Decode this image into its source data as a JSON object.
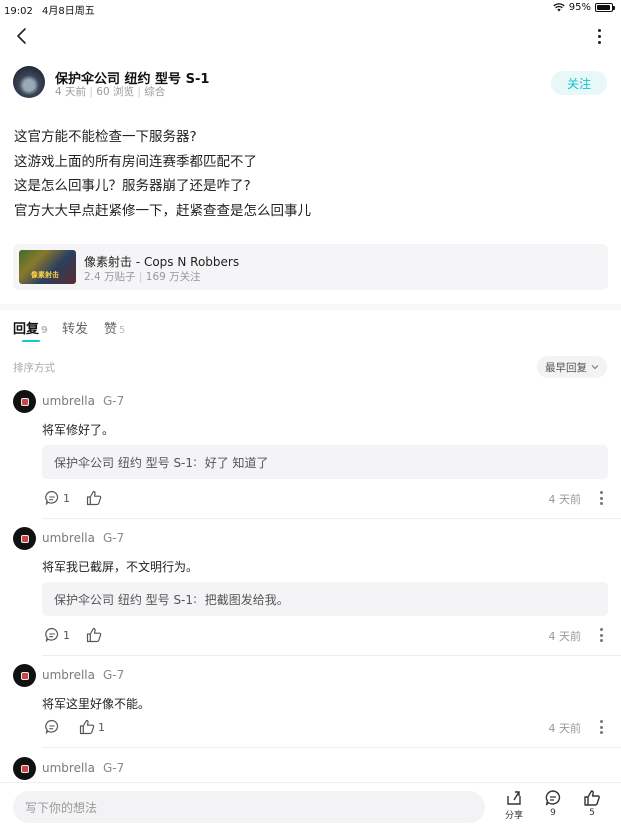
{
  "status_bar": {
    "time": "19:02",
    "date": "4月8日周五",
    "battery": "95%",
    "battery_level": 0.95
  },
  "post": {
    "author": "保护伞公司 纽约 型号 S-1",
    "posted": "4 天前",
    "views": "60 浏览",
    "category": "综合",
    "follow_label": "关注",
    "lines": [
      "这官方能不能检查一下服务器?",
      "这游戏上面的所有房间连赛季都匹配不了",
      "这是怎么回事儿？服务器崩了还是咋了?",
      "官方大大早点赶紧修一下，赶紧查查是怎么回事儿"
    ]
  },
  "game": {
    "name": "像素射击 - Cops N Robbers",
    "posts": "2.4 万贴子",
    "followers": "169 万关注",
    "thumb_text": "像素射击"
  },
  "tabs": [
    {
      "label": "回复",
      "count": "9"
    },
    {
      "label": "转发",
      "count": ""
    },
    {
      "label": "赞",
      "count": "5"
    }
  ],
  "sort": {
    "label": "排序方式",
    "selected": "最早回复"
  },
  "replies": [
    {
      "user": "umbrella",
      "level": "G-7",
      "text": "将军修好了。",
      "quote_author": "保护伞公司 纽约 型号 S-1",
      "quote_text": "好了 知道了",
      "comments": "1",
      "likes": "",
      "time": "4 天前"
    },
    {
      "user": "umbrella",
      "level": "G-7",
      "text": "将军我已截屏，不文明行为。",
      "quote_author": "保护伞公司 纽约 型号 S-1",
      "quote_text": "把截图发给我。",
      "comments": "1",
      "likes": "",
      "time": "4 天前"
    },
    {
      "user": "umbrella",
      "level": "G-7",
      "text": "将军这里好像不能。",
      "quote_author": "",
      "quote_text": "",
      "comments": "",
      "likes": "1",
      "time": "4 天前"
    },
    {
      "user": "umbrella",
      "level": "G-7",
      "text": "",
      "quote_author": "",
      "quote_text": "",
      "comments": "",
      "likes": "",
      "time": ""
    }
  ],
  "bottom": {
    "placeholder": "写下你的想法",
    "share": "分享",
    "comments": "9",
    "likes": "5"
  },
  "colors": {
    "accent": "#15c5ce",
    "follow_bg": "#e8f7f8"
  },
  "icons": [
    "back-icon",
    "more-icon",
    "wifi-icon",
    "battery-icon",
    "comment-icon",
    "like-icon",
    "share-icon",
    "chevron-down-icon"
  ]
}
